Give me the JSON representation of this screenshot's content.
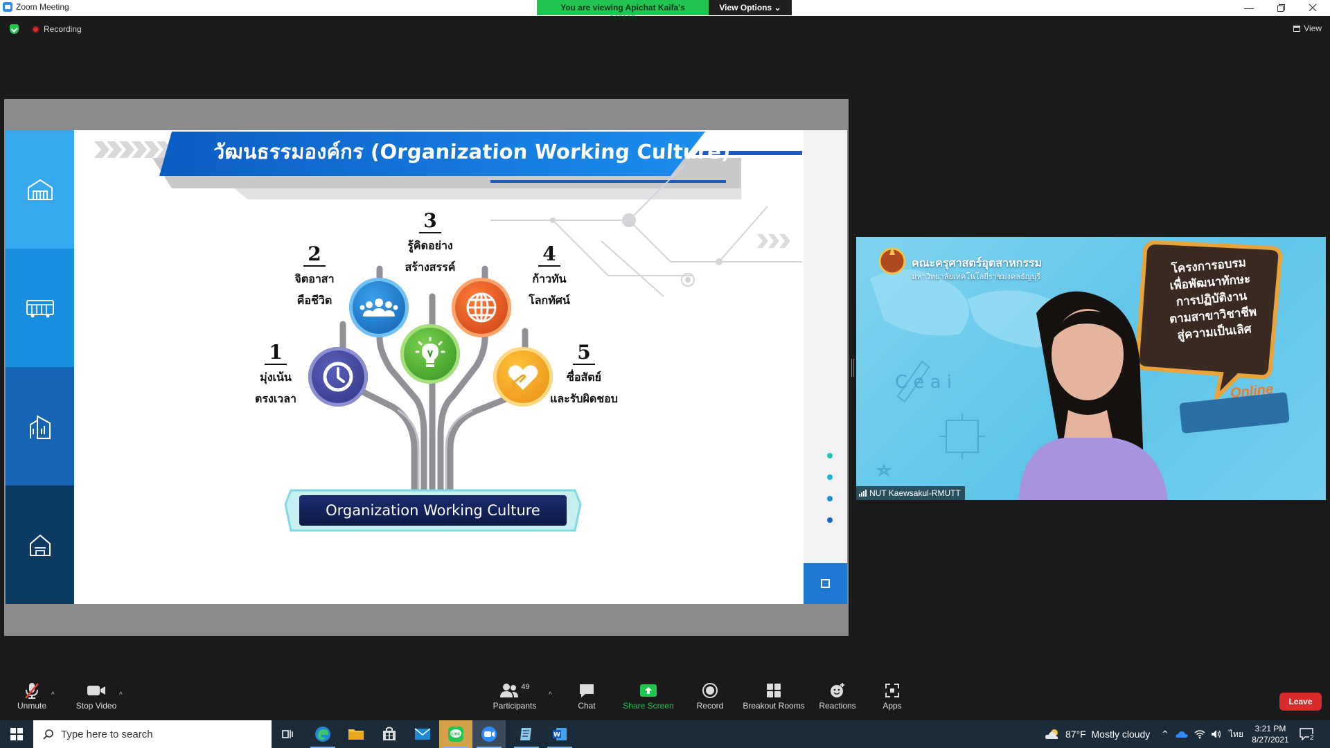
{
  "window": {
    "title": "Zoom Meeting",
    "share_banner": "You are viewing Apichat Kaifa's screen",
    "view_options": "View Options",
    "controls": [
      "minimize-icon",
      "restore-icon",
      "close-icon"
    ]
  },
  "meeting_bar": {
    "recording_label": "Recording",
    "view_label": "View"
  },
  "slide": {
    "title": "วัฒนธรรมองค์กร (Organization Working Culture)",
    "base_label": "Organization Working Culture",
    "items": [
      {
        "number": "1",
        "line1": "มุ่งเน้น",
        "line2": "ตรงเวลา",
        "icon": "clock-icon",
        "color": "#3b3f8f"
      },
      {
        "number": "2",
        "line1": "จิตอาสา",
        "line2": "คือชีวิต",
        "icon": "people-icon",
        "color": "#1776c8"
      },
      {
        "number": "3",
        "line1": "รู้คิดอย่าง",
        "line2": "สร้างสรรค์",
        "icon": "lightbulb-icon",
        "color": "#43a82c"
      },
      {
        "number": "4",
        "line1": "ก้าวทัน",
        "line2": "โลกทัศน์",
        "icon": "globe-icon",
        "color": "#e2541c"
      },
      {
        "number": "5",
        "line1": "ซื่อสัตย์",
        "line2": "และรับผิดชอบ",
        "icon": "heart-hand-icon",
        "color": "#f0a01c"
      }
    ],
    "sidebar_icons": [
      "building-icon",
      "bus-icon",
      "office-icon",
      "home-icon"
    ],
    "sidebar_colors": [
      "#36a9f0",
      "#1a8fe0",
      "#1565b4",
      "#0c3a63"
    ],
    "nav_dot_colors": [
      "#1fc6b0",
      "#12b7d6",
      "#1b8fd8",
      "#1769c7"
    ]
  },
  "video": {
    "participant_name": "NUT Kaewsakul-RMUTT",
    "faculty_th": "คณะครุศาสตร์อุตสาหกรรม",
    "university_th": "มหาวิทยาลัยเทคโนโลยีราชมงคลธัญบุรี",
    "project_lines": [
      "โครงการอบรม",
      "เพื่อพัฒนาทักษะ",
      "การปฏิบัติงาน",
      "ตามสาขาวิชาชีพ",
      "สู่ความเป็นเลิศ"
    ],
    "badge_online": "Online"
  },
  "toolbar": {
    "unmute": "Unmute",
    "stop_video": "Stop Video",
    "participants": "Participants",
    "participants_count": "49",
    "chat": "Chat",
    "share_screen": "Share Screen",
    "record": "Record",
    "breakout_rooms": "Breakout Rooms",
    "reactions": "Reactions",
    "apps": "Apps",
    "leave": "Leave"
  },
  "taskbar": {
    "search_placeholder": "Type here to search",
    "weather": "87°F  Mostly cloudy",
    "language": "ไทย",
    "time": "3:21 PM",
    "date": "8/27/2021",
    "notifications": "2"
  }
}
